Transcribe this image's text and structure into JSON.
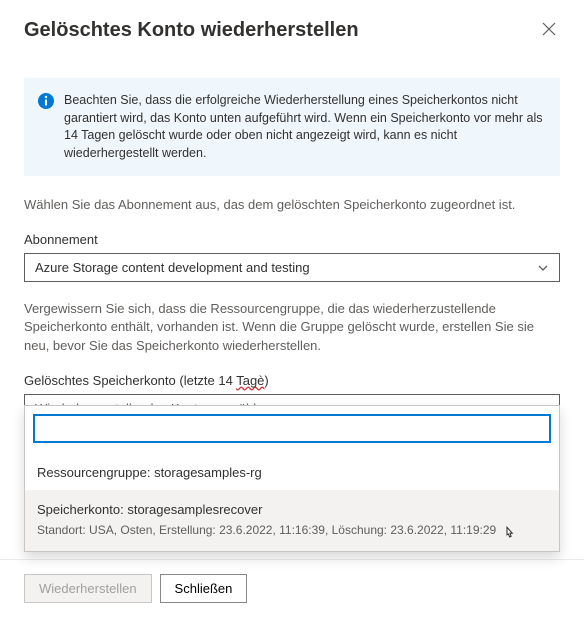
{
  "header": {
    "title": "Gelöschtes Konto wiederherstellen"
  },
  "info": {
    "text": "Beachten Sie, dass die erfolgreiche Wiederherstellung eines Speicherkontos nicht garantiert wird, das Konto unten aufgeführt wird. Wenn ein Speicherkonto vor mehr als 14 Tagen gelöscht wurde oder oben nicht angezeigt wird, kann es nicht wiederhergestellt werden."
  },
  "instruction1": "Wählen Sie das Abonnement aus, das dem gelöschten Speicherkonto zugeordnet ist.",
  "subscription": {
    "label": "Abonnement",
    "value": "Azure Storage content development and testing"
  },
  "instruction2": "Vergewissern Sie sich, dass die Ressourcengruppe, die das wiederherzustellende Speicherkonto enthält, vorhanden ist. Wenn die Gruppe gelöscht wurde, erstellen Sie sie neu, bevor Sie das Speicherkonto wiederherstellen.",
  "deletedAccount": {
    "label_prefix": "Gelöschtes Speicherkonto (letzte 14 ",
    "label_misspelled": "Tagè",
    "label_suffix": ")",
    "placeholder": "Wiederherzustellendes Konto auswählen"
  },
  "dropdown": {
    "groupLabel": "Ressourcengruppe: storagesamples-rg",
    "option": {
      "title": "Speicherkonto: storagesamplesrecover",
      "meta": "Standort: USA, Osten, Erstellung: 23.6.2022, 11:16:39, Löschung: 23.6.2022, 11:19:29"
    }
  },
  "footer": {
    "restore": "Wiederherstellen",
    "close": "Schließen"
  }
}
